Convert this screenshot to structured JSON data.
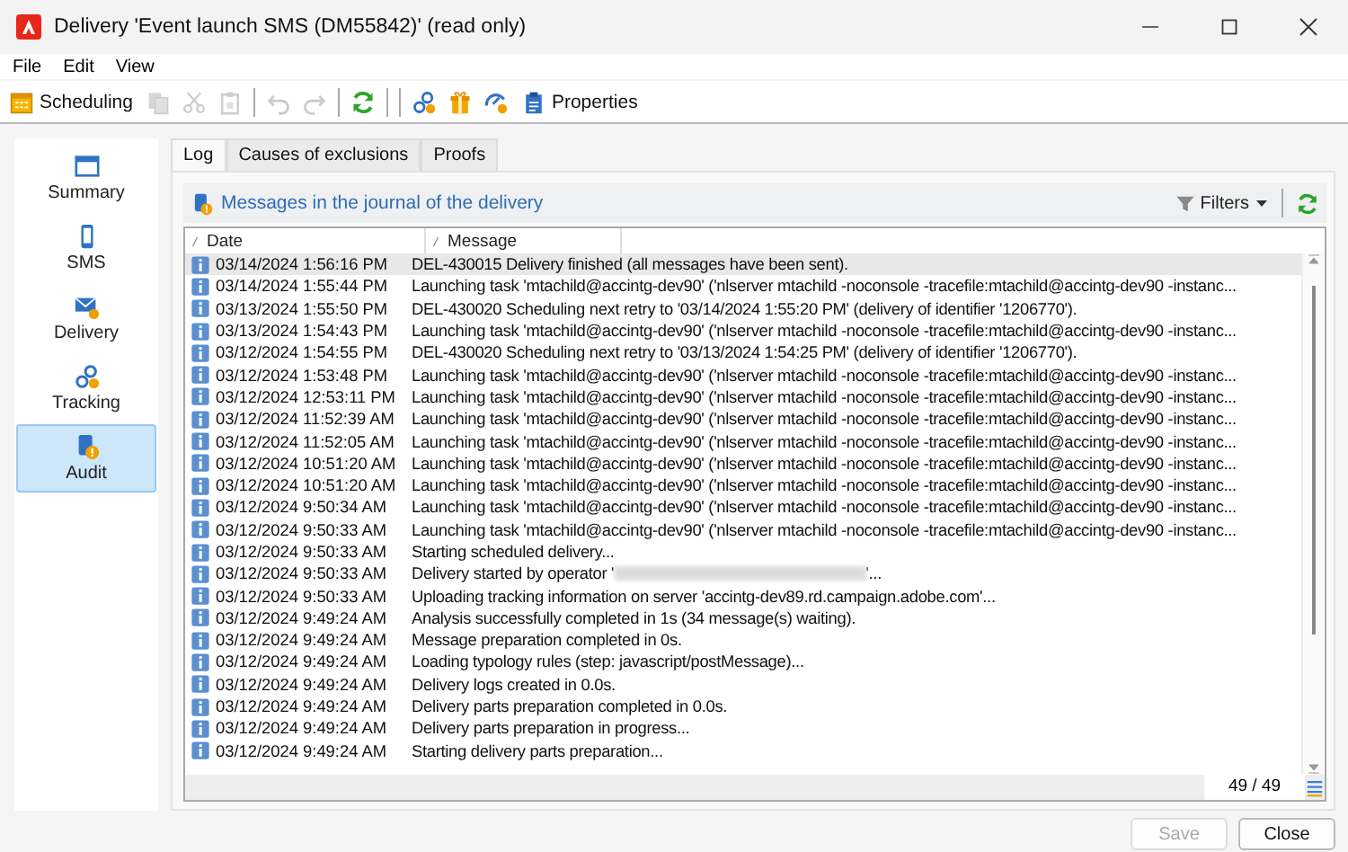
{
  "window": {
    "title": "Delivery 'Event launch SMS (DM55842)' (read only)"
  },
  "menu": [
    "File",
    "Edit",
    "View"
  ],
  "toolbar": [
    {
      "kind": "button",
      "label": "Scheduling",
      "disabled": false
    },
    {
      "kind": "button",
      "disabled": true
    },
    {
      "kind": "button",
      "disabled": true
    },
    {
      "kind": "button",
      "disabled": true
    },
    {
      "kind": "separator"
    },
    {
      "kind": "button",
      "disabled": true
    },
    {
      "kind": "button",
      "disabled": true
    },
    {
      "kind": "separator"
    },
    {
      "kind": "button",
      "disabled": false
    },
    {
      "kind": "separator"
    },
    {
      "kind": "separator"
    },
    {
      "kind": "button",
      "disabled": false
    },
    {
      "kind": "button",
      "disabled": false
    },
    {
      "kind": "button",
      "disabled": false
    },
    {
      "kind": "button",
      "label": "Properties",
      "disabled": false
    }
  ],
  "sidebar": {
    "items": [
      {
        "label": "Summary",
        "selected": false
      },
      {
        "label": "SMS",
        "selected": false
      },
      {
        "label": "Delivery",
        "selected": false
      },
      {
        "label": "Tracking",
        "selected": false
      },
      {
        "label": "Audit",
        "selected": true
      }
    ]
  },
  "tabs": [
    {
      "label": "Log",
      "selected": true
    },
    {
      "label": "Causes of exclusions",
      "selected": false
    },
    {
      "label": "Proofs",
      "selected": false
    }
  ],
  "journal": {
    "title": "Messages in the journal of the delivery",
    "filters": "Filters",
    "columns": [
      "Date",
      "Message"
    ],
    "rows": [
      {
        "date": "03/14/2024 1:56:16 PM",
        "message": "DEL-430015 Delivery finished (all messages have been sent).",
        "selected": true
      },
      {
        "date": "03/14/2024 1:55:44 PM",
        "message": "Launching task 'mtachild@accintg-dev90' ('nlserver mtachild -noconsole -tracefile:mtachild@accintg-dev90 -instanc...",
        "selected": false
      },
      {
        "date": "03/13/2024 1:55:50 PM",
        "message": "DEL-430020 Scheduling next retry to '03/14/2024 1:55:20 PM' (delivery of identifier '1206770').",
        "selected": false
      },
      {
        "date": "03/13/2024 1:54:43 PM",
        "message": "Launching task 'mtachild@accintg-dev90' ('nlserver mtachild -noconsole -tracefile:mtachild@accintg-dev90 -instanc...",
        "selected": false
      },
      {
        "date": "03/12/2024 1:54:55 PM",
        "message": "DEL-430020 Scheduling next retry to '03/13/2024 1:54:25 PM' (delivery of identifier '1206770').",
        "selected": false
      },
      {
        "date": "03/12/2024 1:53:48 PM",
        "message": "Launching task 'mtachild@accintg-dev90' ('nlserver mtachild -noconsole -tracefile:mtachild@accintg-dev90 -instanc...",
        "selected": false
      },
      {
        "date": "03/12/2024 12:53:11 PM",
        "message": "Launching task 'mtachild@accintg-dev90' ('nlserver mtachild -noconsole -tracefile:mtachild@accintg-dev90 -instanc...",
        "selected": false
      },
      {
        "date": "03/12/2024 11:52:39 AM",
        "message": "Launching task 'mtachild@accintg-dev90' ('nlserver mtachild -noconsole -tracefile:mtachild@accintg-dev90 -instanc...",
        "selected": false
      },
      {
        "date": "03/12/2024 11:52:05 AM",
        "message": "Launching task 'mtachild@accintg-dev90' ('nlserver mtachild -noconsole -tracefile:mtachild@accintg-dev90 -instanc...",
        "selected": false
      },
      {
        "date": "03/12/2024 10:51:20 AM",
        "message": "Launching task 'mtachild@accintg-dev90' ('nlserver mtachild -noconsole -tracefile:mtachild@accintg-dev90 -instanc...",
        "selected": false
      },
      {
        "date": "03/12/2024 10:51:20 AM",
        "message": "Launching task 'mtachild@accintg-dev90' ('nlserver mtachild -noconsole -tracefile:mtachild@accintg-dev90 -instanc...",
        "selected": false
      },
      {
        "date": "03/12/2024 9:50:34 AM",
        "message": "Launching task 'mtachild@accintg-dev90' ('nlserver mtachild -noconsole -tracefile:mtachild@accintg-dev90 -instanc...",
        "selected": false
      },
      {
        "date": "03/12/2024 9:50:33 AM",
        "message": "Launching task 'mtachild@accintg-dev90' ('nlserver mtachild -noconsole -tracefile:mtachild@accintg-dev90 -instanc...",
        "selected": false
      },
      {
        "date": "03/12/2024 9:50:33 AM",
        "message": "Starting scheduled delivery...",
        "selected": false
      },
      {
        "date": "03/12/2024 9:50:33 AM",
        "message": "Delivery started by operator '",
        "redacted": true,
        "suffix": "'...",
        "selected": false
      },
      {
        "date": "03/12/2024 9:50:33 AM",
        "message": "Uploading tracking information on server 'accintg-dev89.rd.campaign.adobe.com'...",
        "selected": false
      },
      {
        "date": "03/12/2024 9:49:24 AM",
        "message": "Analysis successfully completed in 1s (34 message(s) waiting).",
        "selected": false
      },
      {
        "date": "03/12/2024 9:49:24 AM",
        "message": "Message preparation completed in 0s.",
        "selected": false
      },
      {
        "date": "03/12/2024 9:49:24 AM",
        "message": "Loading typology rules (step: javascript/postMessage)...",
        "selected": false
      },
      {
        "date": "03/12/2024 9:49:24 AM",
        "message": "Delivery logs created in 0.0s.",
        "selected": false
      },
      {
        "date": "03/12/2024 9:49:24 AM",
        "message": "Delivery parts preparation completed in 0.0s.",
        "selected": false
      },
      {
        "date": "03/12/2024 9:49:24 AM",
        "message": "Delivery parts preparation in progress...",
        "selected": false
      },
      {
        "date": "03/12/2024 9:49:24 AM",
        "message": "Starting delivery parts preparation...",
        "selected": false
      }
    ],
    "count": "49 / 49"
  },
  "buttons": [
    {
      "label": "Save",
      "disabled": true
    },
    {
      "label": "Close",
      "disabled": false
    }
  ]
}
